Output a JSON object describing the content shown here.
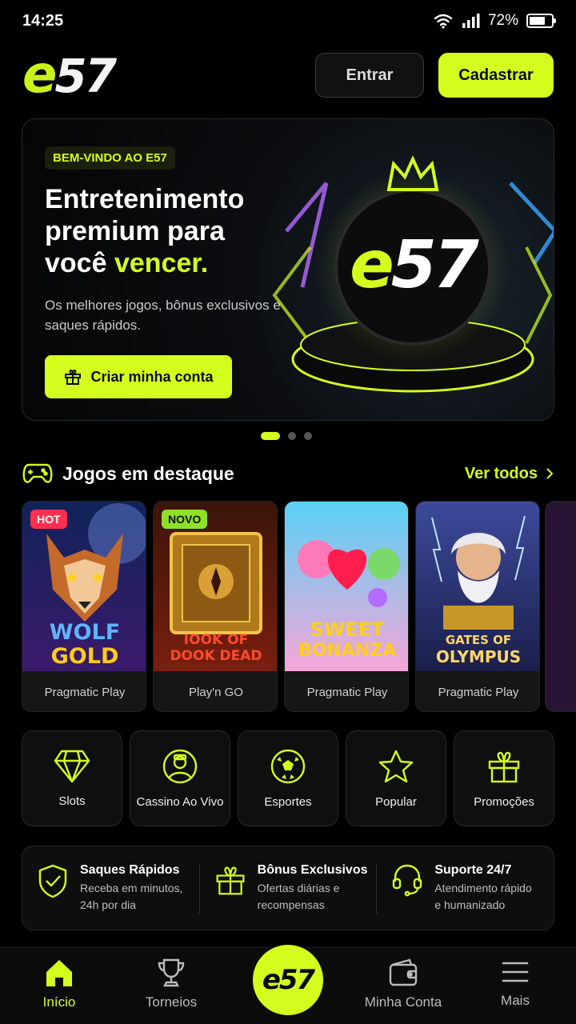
{
  "status": {
    "time": "14:25",
    "battery": "72%",
    "battery_level": 0.72
  },
  "header": {
    "logo_e": "e",
    "logo_num": "57",
    "login_label": "Entrar",
    "signup_label": "Cadastrar"
  },
  "hero": {
    "badge": "BEM-VINDO AO E57",
    "title_line1": "Entretenimento",
    "title_line2": "premium para",
    "title_line3_prefix": "você ",
    "title_accent": "vencer.",
    "subtitle": "Os melhores jogos, bônus exclusivos e saques rápidos.",
    "cta": "Criar minha conta",
    "art_logo_e": "e",
    "art_logo_num": "57"
  },
  "carousel": {
    "slides": 3,
    "active": 1
  },
  "featured": {
    "title": "Jogos em destaque",
    "see_all": "Ver todos",
    "games": [
      {
        "tag": "HOT",
        "title_line1": "WOLF",
        "title_line2": "GOLD",
        "provider": "Pragmatic Play"
      },
      {
        "tag": "NOVO",
        "title_line1": "IOOK OF",
        "title_line2": "DOOK DEAD",
        "provider": "Play'n GO"
      },
      {
        "tag": "",
        "title_line1": "SWEET",
        "title_line2": "BONANZA",
        "provider": "Pragmatic Play"
      },
      {
        "tag": "",
        "title_line1": "GATES OF",
        "title_line2": "OLYMPUS",
        "provider": "Pragmatic Play"
      }
    ]
  },
  "categories": [
    {
      "label": "Slots",
      "icon": "diamond-icon"
    },
    {
      "label": "Cassino Ao Vivo",
      "icon": "dealer-icon"
    },
    {
      "label": "Esportes",
      "icon": "soccer-ball-icon"
    },
    {
      "label": "Popular",
      "icon": "star-icon"
    },
    {
      "label": "Promoções",
      "icon": "gift-icon"
    }
  ],
  "features": [
    {
      "title": "Saques Rápidos",
      "desc_line1": "Receba em minutos,",
      "desc_line2": "24h por dia",
      "icon": "shield-check-icon"
    },
    {
      "title": "Bônus Exclusivos",
      "desc_line1": "Ofertas diárias e",
      "desc_line2": "recompensas",
      "icon": "gift-icon"
    },
    {
      "title": "Suporte 24/7",
      "desc_line1": "Atendimento rápido",
      "desc_line2": "e humanizado",
      "icon": "headset-icon"
    }
  ],
  "nav": {
    "home": "Início",
    "tournaments": "Torneios",
    "center_logo": "e57",
    "account": "Minha Conta",
    "more": "Mais"
  },
  "colors": {
    "accent": "#d4ff1e",
    "hot": "#ff2f4e",
    "new": "#8fe02a",
    "background": "#000000"
  }
}
